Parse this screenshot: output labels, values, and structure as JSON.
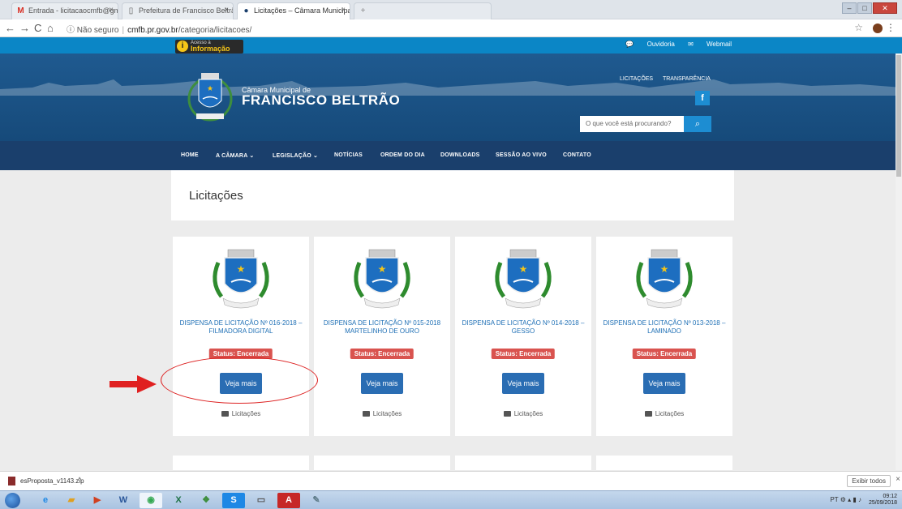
{
  "browser": {
    "tabs": [
      {
        "label": "Entrada - licitacaocmfb@gmail.c",
        "icon": "gmail-icon"
      },
      {
        "label": "Prefeitura de Francisco Beltrão",
        "icon": "page-icon"
      },
      {
        "label": "Licitações – Câmara Municipal d",
        "icon": "site-icon"
      },
      {
        "label": "",
        "icon": "blank-icon"
      }
    ],
    "url_security": "Não seguro",
    "url_domain": "cmfb.pr.gov.br",
    "url_path": "/categoria/licitacoes/"
  },
  "site": {
    "acesso_line1": "Acesso à",
    "acesso_line2": "Informação",
    "ouvidoria": "Ouvidoria",
    "webmail": "Webmail",
    "camara": "Câmara Municipal de",
    "name": "FRANCISCO BELTRÃO",
    "header_links": [
      "LICITAÇÕES",
      "TRANSPARÊNCIA"
    ],
    "facebook": "f",
    "search_placeholder": "O que você está procurando?",
    "nav": [
      "HOME",
      "A CÂMARA ⌄",
      "LEGISLAÇÃO ⌄",
      "NOTÍCIAS",
      "ORDEM DO DIA",
      "DOWNLOADS",
      "SESSÃO AO VIVO",
      "CONTATO"
    ]
  },
  "page_title": "Licitações",
  "cards": [
    {
      "title": "DISPENSA DE LICITAÇÃO Nº 016-2018 – FILMADORA DIGITAL",
      "status": "Status: Encerrada",
      "button": "Veja mais",
      "category": "Licitações"
    },
    {
      "title": "DISPENSA DE LICITAÇÃO Nº 015-2018 MARTELINHO DE OURO",
      "status": "Status: Encerrada",
      "button": "Veja mais",
      "category": "Licitações"
    },
    {
      "title": "DISPENSA DE LICITAÇÃO Nº 014-2018 – GESSO",
      "status": "Status: Encerrada",
      "button": "Veja mais",
      "category": "Licitações"
    },
    {
      "title": "DISPENSA DE LICITAÇÃO Nº 013-2018 – LAMINADO",
      "status": "Status: Encerrada",
      "button": "Veja mais",
      "category": "Licitações"
    }
  ],
  "downloads": {
    "file": "esProposta_v1143.zip",
    "show_all": "Exibir todos"
  },
  "taskbar": {
    "time": "09:12",
    "date": "25/09/2018",
    "lang": "PT"
  },
  "colors": {
    "site_blue": "#0b86c6",
    "nav_dark": "#1a3f6c",
    "status_red": "#d9534f",
    "button_blue": "#2a6db3"
  }
}
